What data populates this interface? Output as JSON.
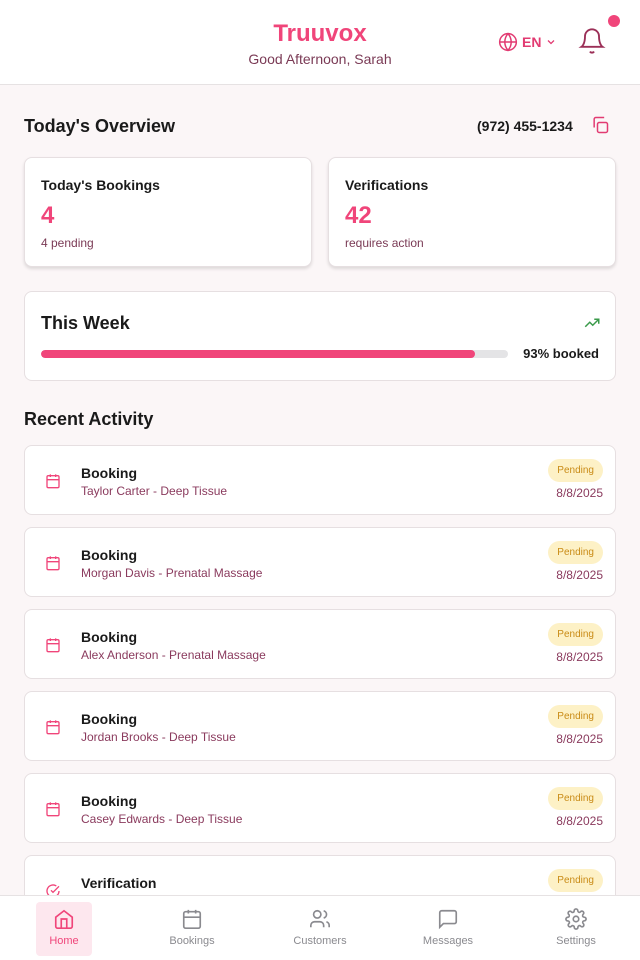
{
  "header": {
    "brand": "Truuvox",
    "greeting": "Good Afternoon, Sarah",
    "language": "EN",
    "notification_dot": true
  },
  "overview": {
    "title": "Today's Overview",
    "phone": "(972) 455-1234",
    "bookings": {
      "label": "Today's Bookings",
      "value": "4",
      "sub": "4 pending"
    },
    "verifications": {
      "label": "Verifications",
      "value": "42",
      "sub": "requires action"
    }
  },
  "week": {
    "title": "This Week",
    "progress_percent": 93,
    "progress_label": "93% booked"
  },
  "recent": {
    "title": "Recent Activity",
    "items": [
      {
        "type": "calendar-icon",
        "title": "Booking",
        "subtitle": "Taylor Carter - Deep Tissue",
        "status": "Pending",
        "date": "8/8/2025"
      },
      {
        "type": "calendar-icon",
        "title": "Booking",
        "subtitle": "Morgan Davis - Prenatal Massage",
        "status": "Pending",
        "date": "8/8/2025"
      },
      {
        "type": "calendar-icon",
        "title": "Booking",
        "subtitle": "Alex Anderson - Prenatal Massage",
        "status": "Pending",
        "date": "8/8/2025"
      },
      {
        "type": "calendar-icon",
        "title": "Booking",
        "subtitle": "Jordan Brooks - Deep Tissue",
        "status": "Pending",
        "date": "8/8/2025"
      },
      {
        "type": "calendar-icon",
        "title": "Booking",
        "subtitle": "Casey Edwards - Deep Tissue",
        "status": "Pending",
        "date": "8/8/2025"
      },
      {
        "type": "check-circle-icon",
        "title": "Verification",
        "subtitle": "",
        "status": "Pending",
        "date": ""
      }
    ]
  },
  "nav": {
    "items": [
      {
        "label": "Home",
        "icon": "home-icon",
        "active": true
      },
      {
        "label": "Bookings",
        "icon": "calendar-icon",
        "active": false
      },
      {
        "label": "Customers",
        "icon": "users-icon",
        "active": false
      },
      {
        "label": "Messages",
        "icon": "message-icon",
        "active": false
      },
      {
        "label": "Settings",
        "icon": "gear-icon",
        "active": false
      }
    ]
  },
  "colors": {
    "accent": "#f0457a",
    "badge_bg": "#fdf1c6",
    "badge_text": "#c98b16",
    "trend": "#3a9a4a"
  }
}
